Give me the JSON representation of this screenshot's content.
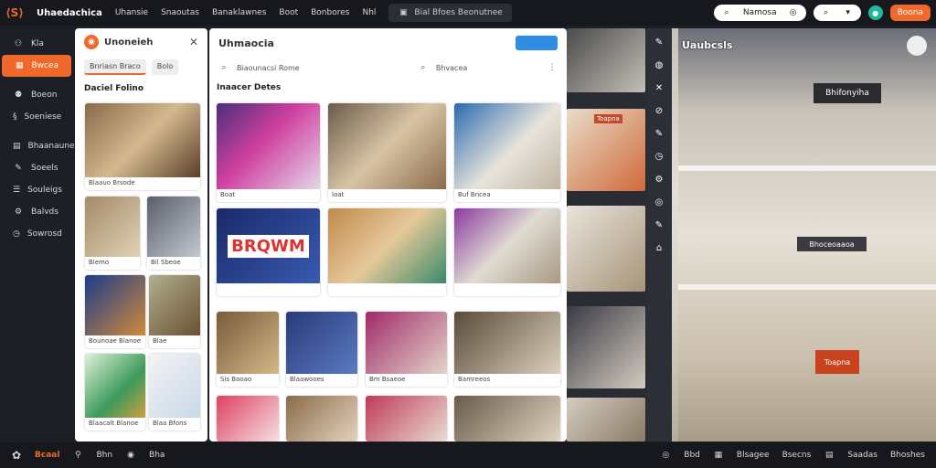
{
  "topbar": {
    "brand": "Uhaedachica",
    "nav": [
      "Uhansie",
      "Snaoutas",
      "Banaklawnes",
      "Boot",
      "Bonbores",
      "Nhl"
    ],
    "search": "Bial Bfoes Beonutnee",
    "pill": "Namosa",
    "btn": "Boona"
  },
  "sidebar": {
    "items": [
      "Kla",
      "Bwcea",
      "Boeon",
      "Soeniese",
      "Bhaanaune",
      "Soeels",
      "Souleigs",
      "Balvds",
      "Sowrosd"
    ]
  },
  "panelA": {
    "title": "Unoneieh",
    "tabs": [
      "Bnriasn Braco",
      "Bolo"
    ],
    "section": "Daciel Folino",
    "cards": [
      "Blaauo Brsode",
      "Blemo",
      "Bil Sbeoe",
      "Bounoae Blanoe",
      "Blae",
      "Blaacalt Blanoe",
      "Blaa Bfons"
    ]
  },
  "panelB": {
    "title": "Uhmaocia",
    "search1": "Biaounacsi Rome",
    "search2": "Bhvacea",
    "section": "Inaacer Detes",
    "cards": [
      "Boat",
      "Ioat",
      "Buf Bncea",
      "Sis Booao",
      "Blaawooes",
      "Bm Bsaeoe",
      "Bamreeos"
    ],
    "billboard": "BRQWM"
  },
  "photo": {
    "sign1": "Uaubcsls",
    "sign2": "Bhifonyiha",
    "sign3": "Bhoceoaaoa",
    "sign4": "Toapna"
  },
  "bottombar": {
    "items": [
      "Bcaal",
      "Bhn",
      "Bha"
    ],
    "right": [
      "Bbd",
      "Blsagee",
      "Bsecns",
      "Saadas",
      "Bhoshes"
    ]
  }
}
